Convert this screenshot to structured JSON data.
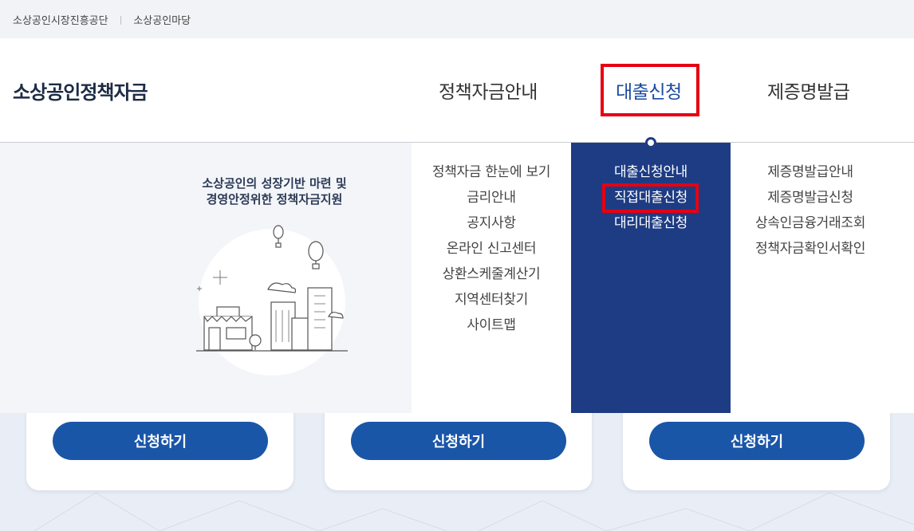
{
  "topbar": {
    "links": [
      "소상공인시장진흥공단",
      "소상공인마당"
    ],
    "separator": "|"
  },
  "header": {
    "logo": "소상공인정책자금"
  },
  "gnb": {
    "items": [
      "정책자금안내",
      "대출신청",
      "제증명발급"
    ]
  },
  "promo": {
    "title_line1": "소상공인의 성장기반 마련 및",
    "title_line2": "경영안정위한 정책자금지원"
  },
  "menu": {
    "col1": [
      "정책자금 한눈에 보기",
      "금리안내",
      "공지사항",
      "온라인 신고센터",
      "상환스케줄계산기",
      "지역센터찾기",
      "사이트맵"
    ],
    "col2": [
      "대출신청안내",
      "직접대출신청",
      "대리대출신청"
    ],
    "col3": [
      "제증명발급안내",
      "제증명발급신청",
      "상속인금융거래조회",
      "정책자금확인서확인"
    ]
  },
  "cards": {
    "button_label": "신청하기"
  },
  "colors": {
    "accent": "#1e3c84",
    "highlight": "#e60012",
    "button": "#1a56a8"
  }
}
